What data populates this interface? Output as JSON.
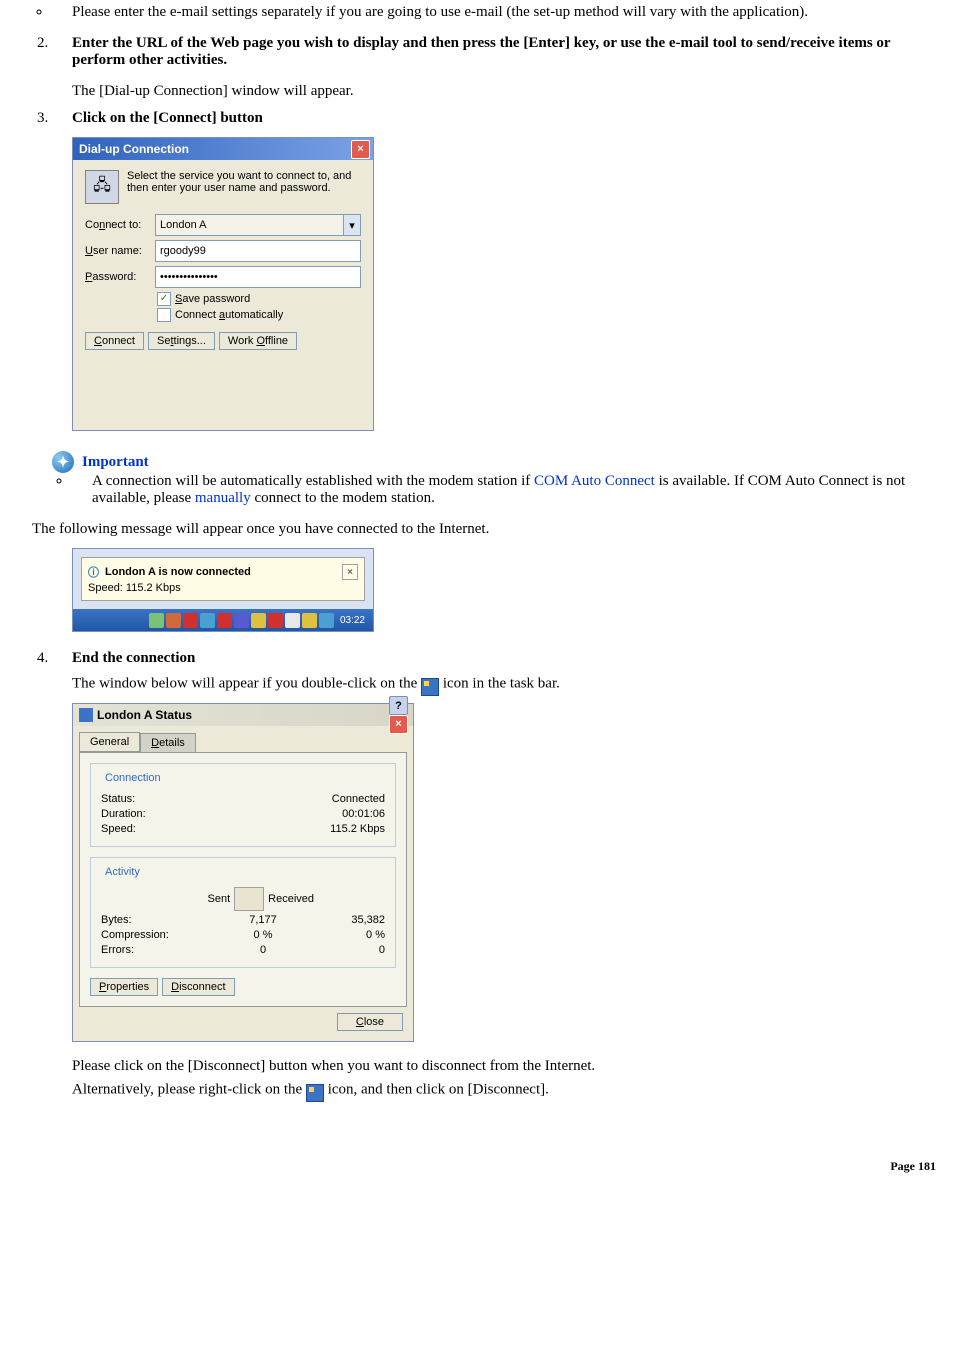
{
  "bullet1": "Please enter the e-mail settings separately if you are going to use e-mail (the set-up method will vary with the application).",
  "step2": {
    "title": "Enter the URL of the Web page you wish to display and then press the [Enter] key, or use the e-mail tool to send/receive items or perform other activities.",
    "note": "The [Dial-up Connection] window will appear."
  },
  "step3": {
    "title": "Click on the [Connect] button"
  },
  "dialog": {
    "title": "Dial-up Connection",
    "intro": "Select the service you want to connect to, and then enter your user name and password.",
    "labels": {
      "connect_to": "Connect to:",
      "user": "User name:",
      "pass": "Password:"
    },
    "values": {
      "connect_to": "London A",
      "user": "rgoody99",
      "pass": "•••••••••••••••"
    },
    "chk_save": "Save password",
    "chk_auto": "Connect automatically",
    "buttons": {
      "connect": "Connect",
      "settings": "Settings...",
      "offline": "Work Offline"
    }
  },
  "important": {
    "label": "Important",
    "text_pre": "A connection will be automatically established with the modem station if ",
    "link1": "COM Auto Connect",
    "text_mid": " is available. If COM Auto Connect is not available, please ",
    "link2": "manually",
    "text_post": " connect to the modem station."
  },
  "connected_msg": "The following message will appear once you have connected to the Internet.",
  "balloon": {
    "title": "London A is now connected",
    "speed": "Speed: 115.2 Kbps",
    "time": "03:22"
  },
  "step4": {
    "title": "End the connection",
    "text_pre": "The window below will appear if you double-click on the ",
    "text_post": " icon in the task bar."
  },
  "status": {
    "title": "London A Status",
    "tabs": {
      "general": "General",
      "details": "Details"
    },
    "connection_legend": "Connection",
    "activity_legend": "Activity",
    "rows": {
      "status_l": "Status:",
      "status_v": "Connected",
      "duration_l": "Duration:",
      "duration_v": "00:01:06",
      "speed_l": "Speed:",
      "speed_v": "115.2 Kbps"
    },
    "act_header": {
      "sent": "Sent",
      "received": "Received"
    },
    "act": {
      "bytes_l": "Bytes:",
      "bytes_s": "7,177",
      "bytes_r": "35,382",
      "comp_l": "Compression:",
      "comp_s": "0 %",
      "comp_r": "0 %",
      "err_l": "Errors:",
      "err_s": "0",
      "err_r": "0"
    },
    "buttons": {
      "properties": "Properties",
      "disconnect": "Disconnect",
      "close": "Close"
    }
  },
  "disconnect_line": "Please click on the [Disconnect] button when you want to disconnect from the Internet.",
  "alt": {
    "pre": "Alternatively, please right-click on the ",
    "post": " icon, and then click on [Disconnect]."
  },
  "footer": "Page 181"
}
